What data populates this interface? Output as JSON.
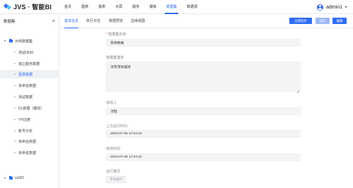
{
  "app": {
    "logo_text": "JVS · 智能BI"
  },
  "nav": {
    "items": [
      {
        "label": "首页"
      },
      {
        "label": "图表"
      },
      {
        "label": "报表"
      },
      {
        "label": "大屏"
      },
      {
        "label": "服务"
      },
      {
        "label": "模板"
      },
      {
        "label": "数据集"
      },
      {
        "label": "数据源"
      }
    ],
    "active_index": 6
  },
  "user": {
    "name": "admin1"
  },
  "sidebar": {
    "title": "数据集",
    "add_label": "+",
    "tree": [
      {
        "label": "示例数据集",
        "type": "folder"
      },
      {
        "label": "测试0630",
        "type": "item"
      },
      {
        "label": "独立服务数据",
        "type": "item"
      },
      {
        "label": "登录数据",
        "type": "item",
        "selected": true
      },
      {
        "label": "未命名数据",
        "type": "item"
      },
      {
        "label": "测试数据",
        "type": "item"
      },
      {
        "label": "DL数据（模向）",
        "type": "item"
      },
      {
        "label": "YH注册",
        "type": "item"
      },
      {
        "label": "账号分析",
        "type": "item"
      },
      {
        "label": "未命名数据",
        "type": "item"
      },
      {
        "label": "未命名数据",
        "type": "item"
      },
      {
        "label": "cs001",
        "type": "folder"
      }
    ]
  },
  "tabs": [
    {
      "label": "基本信息"
    },
    {
      "label": "执行日志"
    },
    {
      "label": "数据预览"
    },
    {
      "label": "血缘视图"
    }
  ],
  "actions": {
    "sync_label": "立即同步",
    "design_label": "设计",
    "edit_label": "编辑"
  },
  "form": {
    "name_label": "数据集名称",
    "name_required": "*",
    "name_value": "登录数据",
    "desc_label": "数据集描述",
    "desc_value": "没有添加描述",
    "owner_label": "修改人",
    "owner_value": "淳壁",
    "last_run_label": "上次运行时间",
    "last_run_value": "2023-07-06 17:04:22",
    "modified_label": "修改时间",
    "modified_value": "2023-07-06 17:04:22",
    "run_mode_label": "运行模式",
    "run_mode_value": "手动运行"
  },
  "colors": {
    "accent": "#2f6cf6",
    "selected_bg": "#eef1f6",
    "field_bg": "#f3f4f6"
  }
}
